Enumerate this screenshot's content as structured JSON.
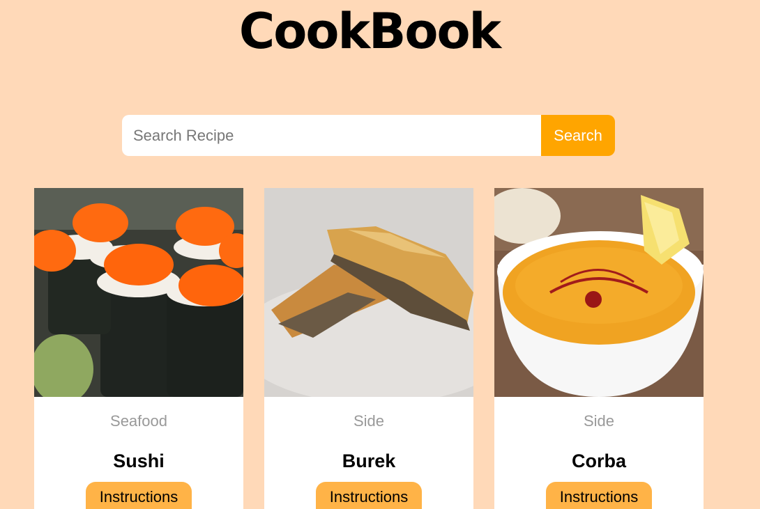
{
  "app": {
    "title": "CookBook"
  },
  "search": {
    "placeholder": "Search Recipe",
    "button_label": "Search"
  },
  "recipes": [
    {
      "category": "Seafood",
      "name": "Sushi",
      "button_label": "Instructions"
    },
    {
      "category": "Side",
      "name": "Burek",
      "button_label": "Instructions"
    },
    {
      "category": "Side",
      "name": "Corba",
      "button_label": "Instructions"
    }
  ],
  "colors": {
    "background": "#ffd9b8",
    "accent": "#ffa500",
    "button": "#ffb347"
  }
}
